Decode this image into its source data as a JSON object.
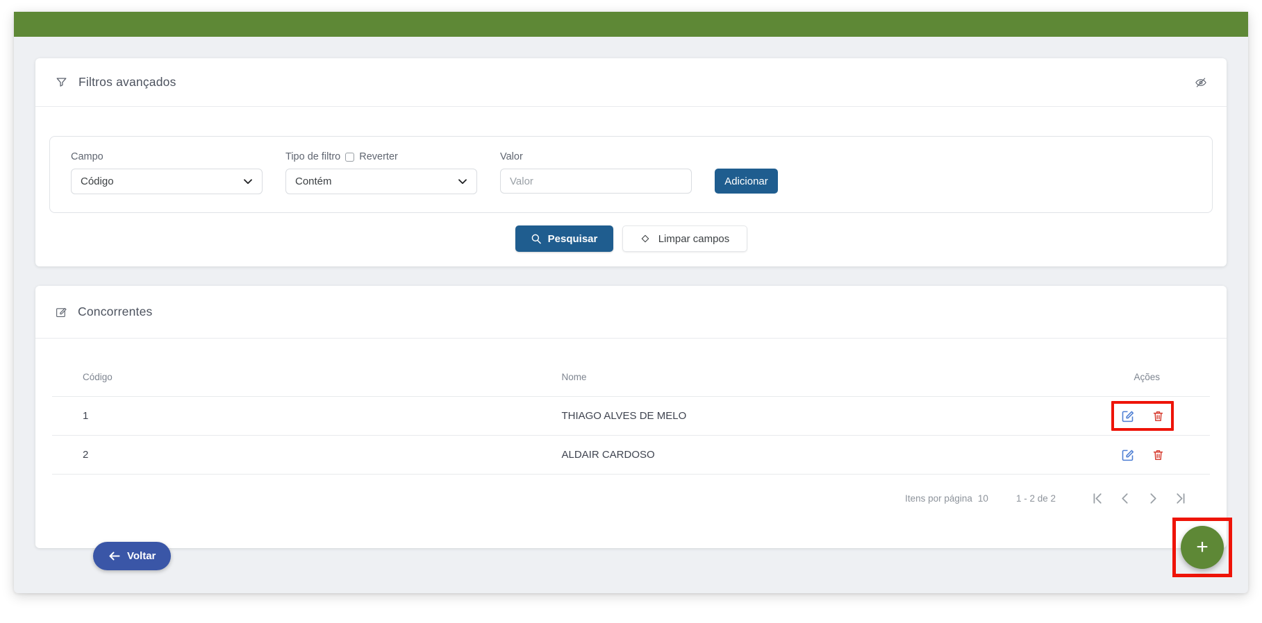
{
  "colors": {
    "brand_green": "#5e8836",
    "primary_blue": "#1f5d8f",
    "back_button_blue": "#3a56a7",
    "edit_icon_blue": "#4d7ed3",
    "delete_icon_red": "#d6392c",
    "annotation_red": "#ee1408",
    "page_background": "#eef0f3"
  },
  "filters": {
    "title": "Filtros avançados",
    "campo_label": "Campo",
    "campo_value": "Código",
    "tipo_label": "Tipo de filtro",
    "reverter_label": "Reverter",
    "tipo_value": "Contém",
    "valor_label": "Valor",
    "valor_placeholder": "Valor",
    "valor_value": "",
    "adicionar_label": "Adicionar",
    "pesquisar_label": "Pesquisar",
    "limpar_label": "Limpar campos"
  },
  "concorrentes": {
    "title": "Concorrentes",
    "columns": {
      "codigo": "Código",
      "nome": "Nome",
      "acoes": "Ações"
    },
    "rows": [
      {
        "codigo": "1",
        "nome": "THIAGO ALVES DE MELO"
      },
      {
        "codigo": "2",
        "nome": "ALDAIR CARDOSO"
      }
    ],
    "pagination": {
      "items_per_page_label": "Itens por página",
      "items_per_page_value": "10",
      "range": "1 - 2 de 2"
    }
  },
  "voltar_label": "Voltar",
  "fab_plus": "+"
}
